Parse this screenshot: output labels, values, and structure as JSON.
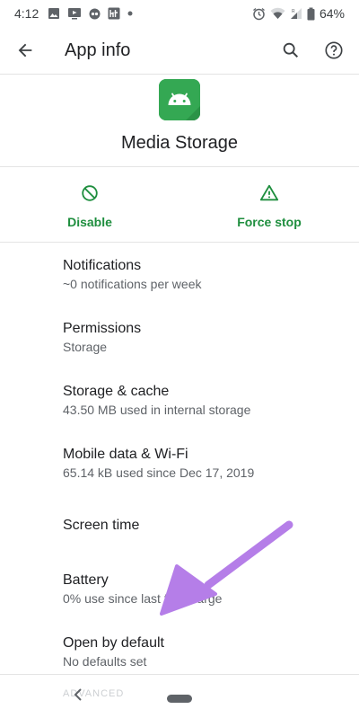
{
  "status_bar": {
    "time": "4:12",
    "battery_percent": "64%",
    "left_icons": [
      "image-icon",
      "cast-screen-icon",
      "app-notification-icon",
      "ht-icon",
      "dot-icon"
    ],
    "right_icons": [
      "alarm-icon",
      "wifi-icon",
      "signal-icon",
      "battery-icon"
    ]
  },
  "app_bar": {
    "title": "App info",
    "back_icon": "arrow-back-icon",
    "actions": [
      "search-icon",
      "help-icon"
    ]
  },
  "app": {
    "name": "Media Storage",
    "icon": "android-robot-icon",
    "icon_color": "#34a853"
  },
  "actions": [
    {
      "label": "Disable",
      "icon": "disable-icon"
    },
    {
      "label": "Force stop",
      "icon": "warning-icon"
    }
  ],
  "accent_color": "#1e8e3e",
  "settings": [
    {
      "title": "Notifications",
      "summary": "~0 notifications per week"
    },
    {
      "title": "Permissions",
      "summary": "Storage"
    },
    {
      "title": "Storage & cache",
      "summary": "43.50 MB used in internal storage"
    },
    {
      "title": "Mobile data & Wi-Fi",
      "summary": "65.14 kB used since Dec 17, 2019"
    },
    {
      "title": "Screen time",
      "summary": ""
    },
    {
      "title": "Battery",
      "summary": "0% use since last full charge"
    },
    {
      "title": "Open by default",
      "summary": "No defaults set"
    }
  ],
  "advanced_label": "ADVANCED",
  "annotation_color": "#b57ee8"
}
